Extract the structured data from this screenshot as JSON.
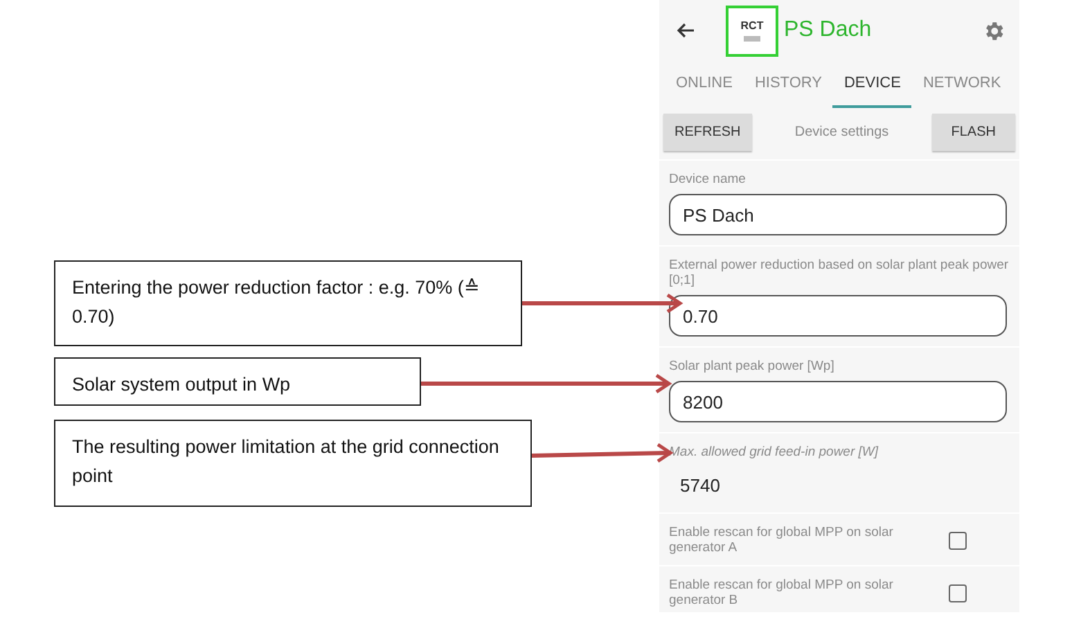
{
  "header": {
    "logo_text": "RCT",
    "title": "PS Dach"
  },
  "tabs": [
    {
      "label": "ONLINE",
      "selected": false
    },
    {
      "label": "HISTORY",
      "selected": false
    },
    {
      "label": "DEVICE",
      "selected": true
    },
    {
      "label": "NETWORK",
      "selected": false
    }
  ],
  "toolbar": {
    "refresh_button": "REFRESH",
    "caption": "Device settings",
    "flash_button": "FLASH"
  },
  "settings": [
    {
      "kind": "field",
      "label": "Device name",
      "value": "PS Dach"
    },
    {
      "kind": "field",
      "label": "External power reduction based on solar plant peak power [0;1]",
      "value": "0.70"
    },
    {
      "kind": "field",
      "label": "Solar plant peak power [Wp]",
      "value": "8200"
    },
    {
      "kind": "readout",
      "label": "Max. allowed grid feed-in power [W]",
      "value": "5740"
    },
    {
      "kind": "checkbox",
      "label": "Enable rescan for global MPP on solar generator A",
      "checked": false
    },
    {
      "kind": "checkbox",
      "label": "Enable rescan for global MPP on solar generator B",
      "checked": false
    }
  ],
  "annotations": [
    "Entering the power reduction factor : e.g. 70% (≙ 0.70)",
    "Solar system output in Wp",
    "The resulting power limitation at the grid connection point"
  ]
}
